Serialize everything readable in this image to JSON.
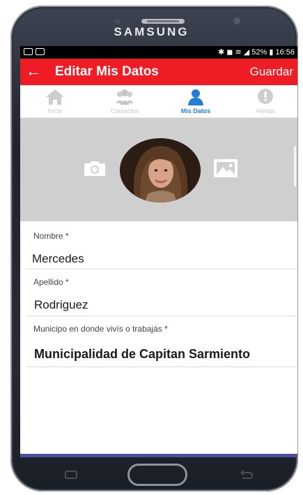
{
  "device": {
    "brand": "SAMSUNG"
  },
  "status_bar": {
    "right_text": "✱ ◼ ≋ ◢ 52% ▮ 16:56"
  },
  "app_bar": {
    "back_icon": "arrow-left-icon",
    "title": "Editar Mis Datos",
    "save_label": "Guardar"
  },
  "tabs": [
    {
      "icon": "home-icon",
      "label": "Inicio"
    },
    {
      "icon": "contacts-icon",
      "label": "Contactos"
    },
    {
      "icon": "person-icon",
      "label": "Mis Datos"
    },
    {
      "icon": "alert-icon",
      "label": "Alertas"
    }
  ],
  "active_tab": 2,
  "profile": {
    "camera_icon": "camera-icon",
    "gallery_icon": "image-gallery-icon"
  },
  "form": {
    "nombre": {
      "label": "Nombre *",
      "value": "Mercedes"
    },
    "apellido": {
      "label": "Apellido *",
      "value": "Rodriguez"
    },
    "municipio": {
      "label": "Municipo en donde vivís o trabajás *",
      "value": "Municipalidad de Capitan Sarmiento"
    }
  },
  "colors": {
    "accent_red": "#ee1c25",
    "active_blue": "#1f7fd6",
    "cover_gray": "#cfcfcf"
  }
}
